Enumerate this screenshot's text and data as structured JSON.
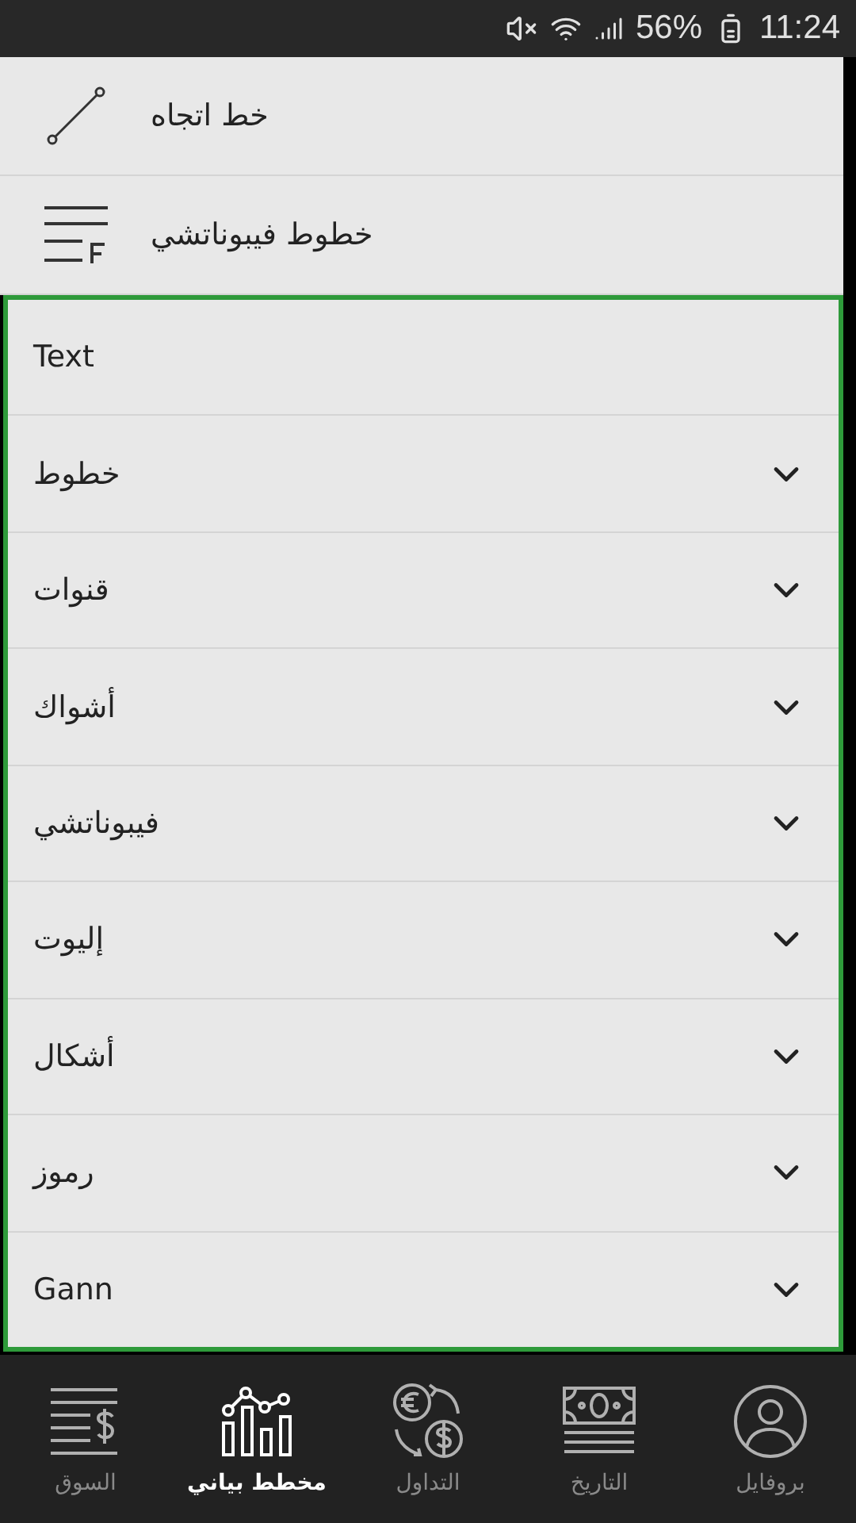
{
  "status_bar": {
    "battery": "56%",
    "time": "11:24"
  },
  "tools": [
    {
      "label": "خط اتجاه",
      "kind": "trendline"
    },
    {
      "label": "خطوط فيبوناتشي",
      "kind": "fibonacci"
    }
  ],
  "categories": [
    {
      "label": "Text",
      "expandable": false
    },
    {
      "label": "خطوط",
      "expandable": true
    },
    {
      "label": "قنوات",
      "expandable": true
    },
    {
      "label": "أشواك",
      "expandable": true
    },
    {
      "label": "فيبوناتشي",
      "expandable": true
    },
    {
      "label": "إليوت",
      "expandable": true
    },
    {
      "label": "أشكال",
      "expandable": true
    },
    {
      "label": "رموز",
      "expandable": true
    },
    {
      "label": "Gann",
      "expandable": true
    }
  ],
  "nav": [
    {
      "label": "بروفايل",
      "kind": "profile",
      "selected": false
    },
    {
      "label": "التاريخ",
      "kind": "history",
      "selected": false
    },
    {
      "label": "التداول",
      "kind": "trade",
      "selected": false
    },
    {
      "label": "مخطط بياني",
      "kind": "chart",
      "selected": true
    },
    {
      "label": "السوق",
      "kind": "market",
      "selected": false
    }
  ]
}
